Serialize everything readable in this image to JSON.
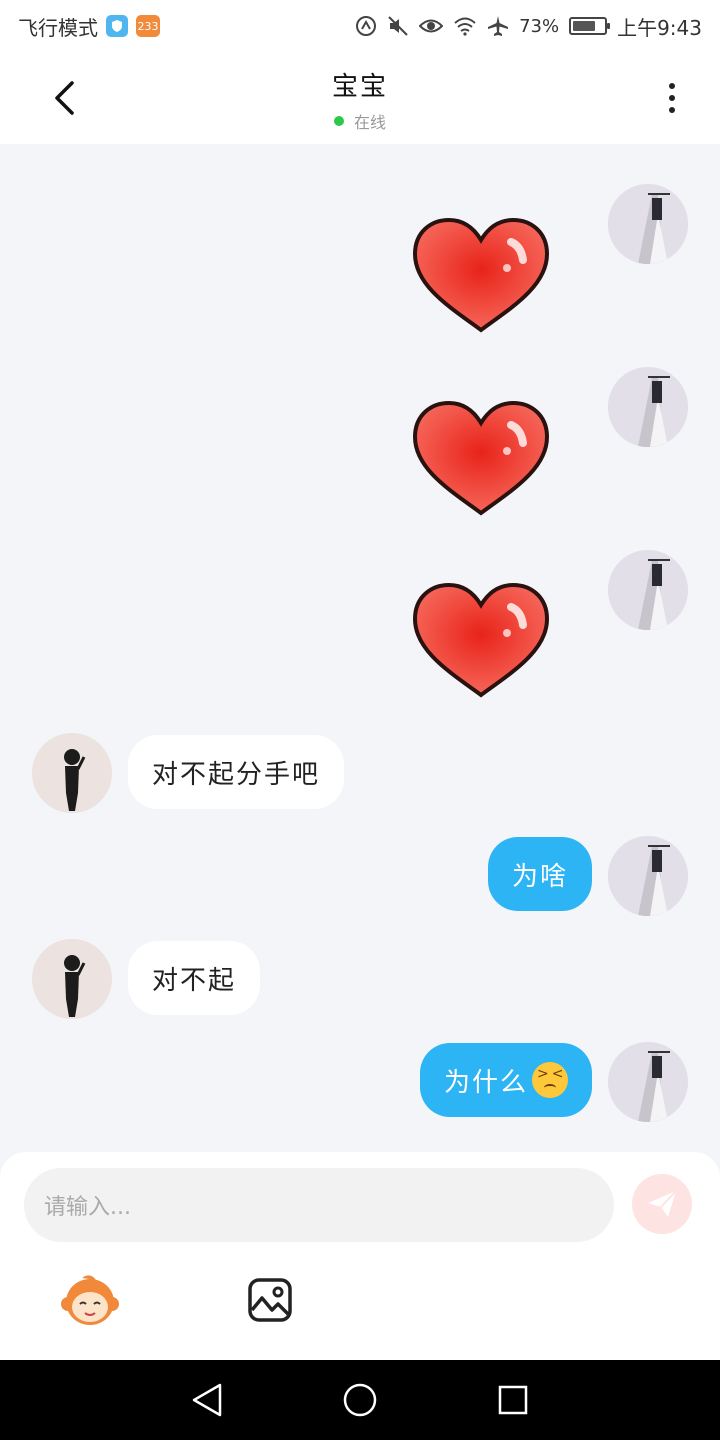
{
  "status_bar": {
    "left_text": "飞行模式",
    "badge_count": "233",
    "battery_percent": "73%",
    "battery_level": 0.73,
    "time": "上午9:43"
  },
  "header": {
    "title": "宝宝",
    "presence": "在线"
  },
  "messages": [
    {
      "from": "me",
      "type": "sticker",
      "sticker": "heart"
    },
    {
      "from": "me",
      "type": "sticker",
      "sticker": "heart"
    },
    {
      "from": "me",
      "type": "sticker",
      "sticker": "heart"
    },
    {
      "from": "other",
      "type": "text",
      "text": "对不起分手吧"
    },
    {
      "from": "me",
      "type": "text",
      "text": "为啥"
    },
    {
      "from": "other",
      "type": "text",
      "text": "对不起"
    },
    {
      "from": "me",
      "type": "text",
      "text": "为什么",
      "emoji": "persevering-face"
    }
  ],
  "composer": {
    "placeholder": "请输入..."
  },
  "icons": {
    "back": "chevron-left-icon",
    "more": "more-vertical-icon",
    "send": "paper-plane-icon",
    "sticker": "monkey-sticker-icon",
    "image": "image-icon"
  },
  "colors": {
    "outgoing_bubble": "#2db4f5",
    "incoming_bubble": "#ffffff",
    "online": "#2bc84a",
    "background": "#f3f5f8"
  }
}
